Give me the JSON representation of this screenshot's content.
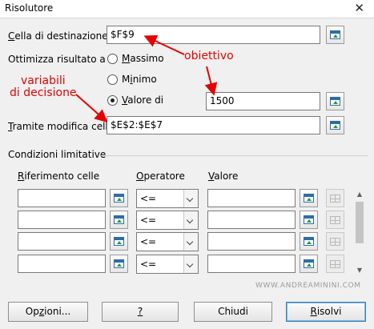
{
  "window": {
    "title": "Risolutore",
    "close_glyph": "✕"
  },
  "target_cell": {
    "label": "Cella di destinazione",
    "underline": "C",
    "rest": "ella di destinazione",
    "value": "$F$9"
  },
  "optimize": {
    "label": "Ottimizza risultato a",
    "options": [
      {
        "id": "max",
        "ul": "M",
        "rest": "assimo",
        "text": "Massimo",
        "selected": false
      },
      {
        "id": "min",
        "ul": "",
        "pre": "M",
        "mid": "i",
        "rest": "nimo",
        "text": "Minimo",
        "selected": false
      },
      {
        "id": "val",
        "ul": "V",
        "rest": "alore di",
        "text": "Valore di",
        "selected": true
      }
    ],
    "value_of": "1500"
  },
  "changing_cells": {
    "ul": "T",
    "rest": "ramite modifica celle",
    "label": "Tramite modifica celle",
    "value": "$E$2:$E$7"
  },
  "constraints": {
    "section_label": "Condizioni limitative",
    "headers": {
      "ref_ul": "R",
      "ref_rest": "iferimento celle",
      "op_ul": "O",
      "op_rest": "peratore",
      "val_ul": "V",
      "val_rest": "alore"
    },
    "rows": [
      {
        "ref": "",
        "operator": "<=",
        "value": ""
      },
      {
        "ref": "",
        "operator": "<=",
        "value": ""
      },
      {
        "ref": "",
        "operator": "<=",
        "value": ""
      },
      {
        "ref": "",
        "operator": "<=",
        "value": ""
      }
    ]
  },
  "buttons": {
    "options": {
      "ul": "z",
      "pre": "Op",
      "post": "ioni..."
    },
    "help": {
      "label": "?"
    },
    "close": {
      "label": "Chiudi"
    },
    "solve": {
      "ul": "R",
      "rest": "isolvi"
    }
  },
  "annotations": {
    "objective": "obiettivo",
    "decision_vars_line1": "variabili",
    "decision_vars_line2": "di decisione",
    "color": "#e60000"
  },
  "watermark": "WWW.ANDREAMININI.COM",
  "icons": {
    "shrink": "shrink-dialog-icon",
    "delete": "remove-row-icon"
  }
}
